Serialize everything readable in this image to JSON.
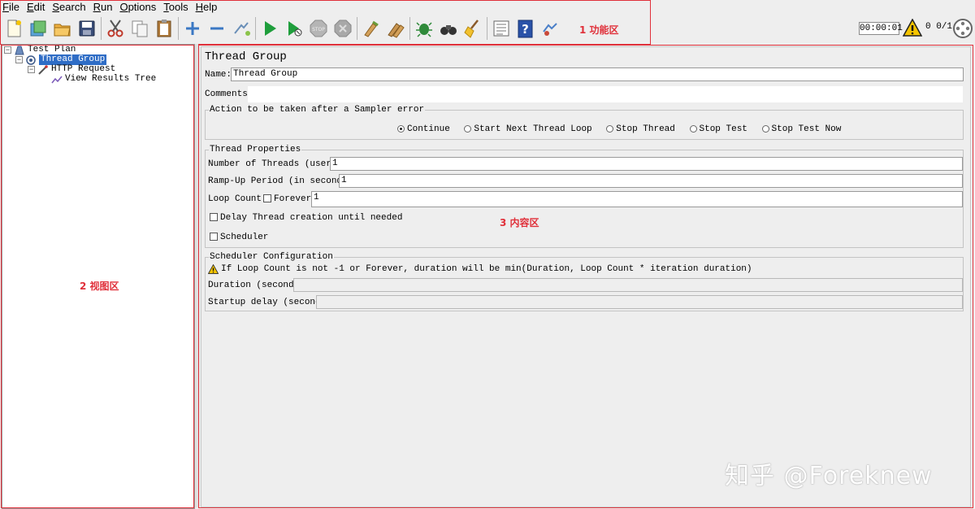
{
  "menu": {
    "items": [
      {
        "key": "F",
        "rest": "ile"
      },
      {
        "key": "E",
        "rest": "dit"
      },
      {
        "key": "S",
        "rest": "earch"
      },
      {
        "key": "R",
        "rest": "un"
      },
      {
        "key": "O",
        "rest": "ptions"
      },
      {
        "key": "T",
        "rest": "ools"
      },
      {
        "key": "H",
        "rest": "elp"
      }
    ]
  },
  "toolbar": {
    "icons": [
      "new-icon",
      "templates-icon",
      "open-icon",
      "save-icon",
      "cut-icon",
      "copy-icon",
      "paste-icon",
      "expand-icon",
      "collapse-icon",
      "toggle-icon",
      "start-icon",
      "start-no-pauses-icon",
      "stop-icon",
      "shutdown-icon",
      "clear-icon",
      "clear-all-icon",
      "search-icon",
      "reset-search-icon",
      "broom-icon",
      "function-helper-icon",
      "help-icon",
      "remote-icon"
    ],
    "timer": "00:00:01",
    "counts": "0 0/1"
  },
  "annotations": {
    "toolbar": "1 功能区",
    "tree": "2 视图区",
    "content": "3 内容区"
  },
  "tree": {
    "test_plan": "Test Plan",
    "thread_group": "Thread Group",
    "http_request": "HTTP Request",
    "view_results_tree": "View Results Tree"
  },
  "form": {
    "title": "Thread Group",
    "name_label": "Name:",
    "name_value": "Thread Group",
    "comments_label": "Comments:",
    "comments_value": "",
    "sampler_error": {
      "legend": "Action to be taken after a Sampler error",
      "options": [
        "Continue",
        "Start Next Thread Loop",
        "Stop Thread",
        "Stop Test",
        "Stop Test Now"
      ],
      "selected": "Continue"
    },
    "thread_props": {
      "legend": "Thread Properties",
      "threads_label": "Number of Threads (users):",
      "threads_value": "1",
      "rampup_label": "Ramp-Up Period (in seconds):",
      "rampup_value": "1",
      "loop_label": "Loop Count:",
      "forever_label": "Forever",
      "forever_checked": false,
      "loop_value": "1",
      "delay_label": "Delay Thread creation until needed",
      "delay_checked": false,
      "scheduler_label": "Scheduler",
      "scheduler_checked": false
    },
    "scheduler": {
      "legend": "Scheduler Configuration",
      "warning": "If Loop Count is not -1 or Forever, duration will be min(Duration, Loop Count * iteration duration)",
      "duration_label": "Duration (seconds)",
      "duration_value": "",
      "startup_label": "Startup delay (seconds)",
      "startup_value": ""
    }
  },
  "watermark": "知乎 @Foreknew",
  "colors": {
    "annotation": "#e0303a",
    "selection": "#2f6dc6"
  }
}
